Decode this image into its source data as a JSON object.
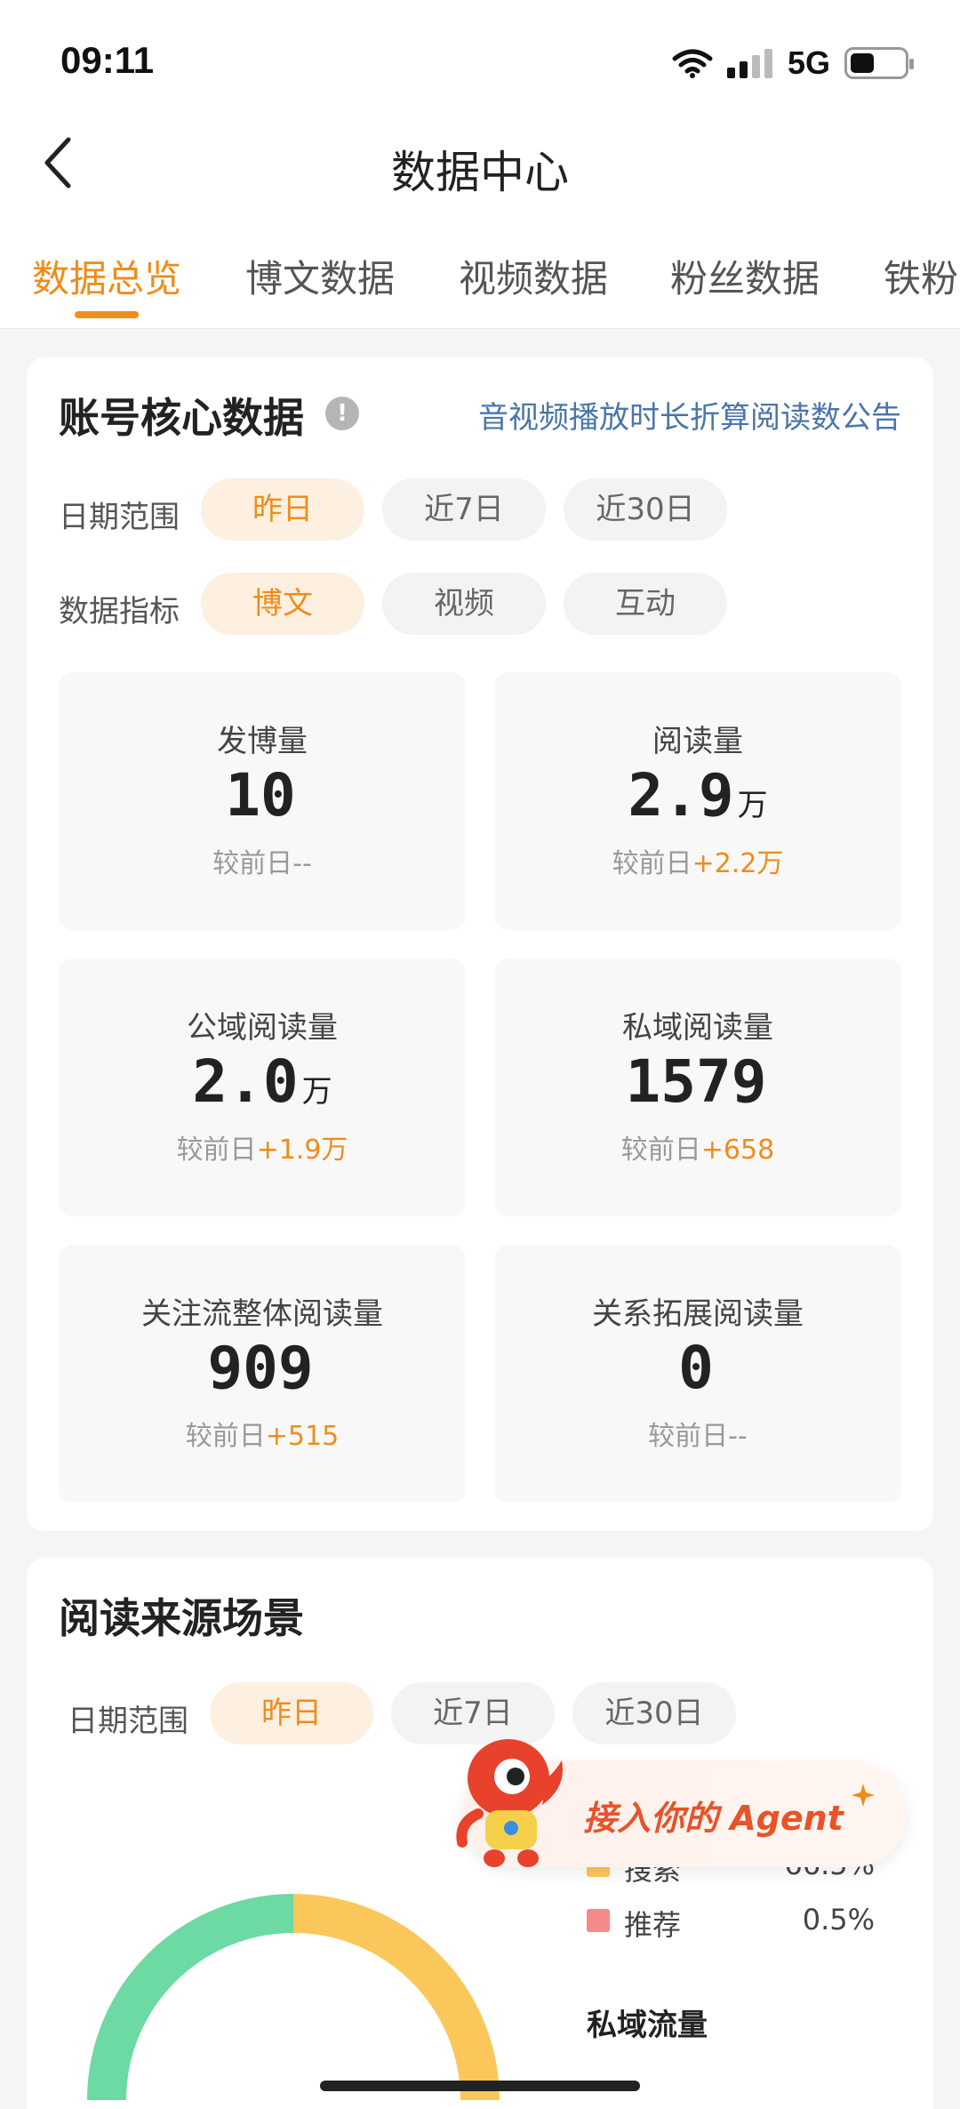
{
  "status_bar": {
    "time": "09:11",
    "network": "5G",
    "battery_level": 0.45
  },
  "nav": {
    "title": "数据中心"
  },
  "tabs": [
    {
      "label": "数据总览",
      "active": true
    },
    {
      "label": "博文数据",
      "active": false
    },
    {
      "label": "视频数据",
      "active": false
    },
    {
      "label": "粉丝数据",
      "active": false
    },
    {
      "label": "铁粉数",
      "active": false
    }
  ],
  "core": {
    "title": "账号核心数据",
    "info_icon_text": "!",
    "notice_link": "音视频播放时长折算阅读数公告",
    "date_range": {
      "label": "日期范围",
      "options": [
        "昨日",
        "近7日",
        "近30日"
      ],
      "selected": "昨日"
    },
    "metric_type": {
      "label": "数据指标",
      "options": [
        "博文",
        "视频",
        "互动"
      ],
      "selected": "博文"
    },
    "compare_prefix": "较前日",
    "metrics": [
      {
        "label": "发博量",
        "value": "10",
        "unit": "",
        "delta": "--",
        "delta_highlight": false
      },
      {
        "label": "阅读量",
        "value": "2.9",
        "unit": "万",
        "delta": "+2.2万",
        "delta_highlight": true
      },
      {
        "label": "公域阅读量",
        "value": "2.0",
        "unit": "万",
        "delta": "+1.9万",
        "delta_highlight": true
      },
      {
        "label": "私域阅读量",
        "value": "1579",
        "unit": "",
        "delta": "+658",
        "delta_highlight": true
      },
      {
        "label": "关注流整体阅读量",
        "value": "909",
        "unit": "",
        "delta": "+515",
        "delta_highlight": true
      },
      {
        "label": "关系拓展阅读量",
        "value": "0",
        "unit": "",
        "delta": "--",
        "delta_highlight": false
      }
    ]
  },
  "source": {
    "title": "阅读来源场景",
    "date_range": {
      "label": "日期范围",
      "options": [
        "昨日",
        "近7日",
        "近30日"
      ],
      "selected": "昨日"
    },
    "legend": [
      {
        "label": "搜索",
        "value": "66.5%",
        "color": "#fcc75a"
      },
      {
        "label": "推荐",
        "value": "0.5%",
        "color": "#f48a8a"
      }
    ],
    "subheading": "私域流量",
    "donut_colors": {
      "left": "#6dd9a3",
      "right": "#fcc75a"
    }
  },
  "agent_banner": {
    "text": "接入你的 Agent"
  }
}
